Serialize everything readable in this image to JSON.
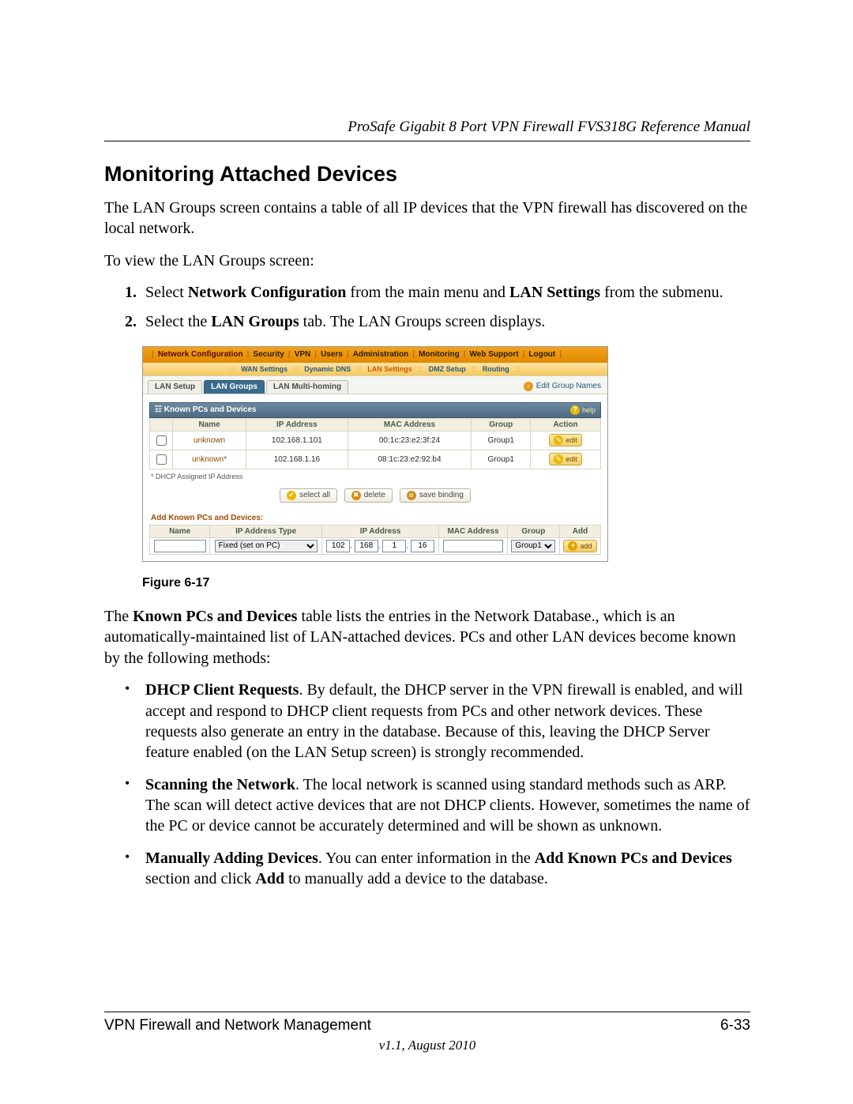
{
  "header": {
    "running_title": "ProSafe Gigabit 8 Port VPN Firewall FVS318G Reference Manual"
  },
  "section_title": "Monitoring Attached Devices",
  "paragraphs": {
    "intro": "The LAN Groups screen contains a table of all IP devices that the VPN firewall has discovered on the local network.",
    "to_view": "To view the LAN Groups screen:",
    "after_figure_pre": "The ",
    "after_figure_bold": "Known PCs and Devices",
    "after_figure_post": " table lists the entries in the Network Database., which is an automatically-maintained list of LAN-attached devices. PCs and other LAN devices become known by the following methods:"
  },
  "steps": {
    "s1_pre": "Select ",
    "s1_b1": "Network Configuration",
    "s1_mid": " from the main menu and ",
    "s1_b2": "LAN Settings",
    "s1_post": " from the submenu.",
    "s2_pre": "Select the ",
    "s2_b1": "LAN Groups",
    "s2_post": " tab. The LAN Groups screen displays."
  },
  "figure": {
    "caption": "Figure 6-17",
    "nav": [
      "Network Configuration",
      "Security",
      "VPN",
      "Users",
      "Administration",
      "Monitoring",
      "Web Support",
      "Logout"
    ],
    "subnav": [
      "WAN Settings",
      "Dynamic DNS",
      "LAN Settings",
      "DMZ Setup",
      "Routing"
    ],
    "subnav_selected_index": 2,
    "tabs": [
      "LAN Setup",
      "LAN Groups",
      "LAN Multi-homing"
    ],
    "tabs_active_index": 1,
    "edit_group_names": "Edit Group Names",
    "panel_title": "Known PCs and Devices",
    "help_label": "help",
    "columns": [
      "Name",
      "IP Address",
      "MAC Address",
      "Group",
      "Action"
    ],
    "rows": [
      {
        "name": "unknown",
        "ip": "102.168.1.101",
        "mac": "00:1c:23:e2:3f:24",
        "group": "Group1",
        "action": "edit"
      },
      {
        "name": "unknown*",
        "ip": "102.168.1.16",
        "mac": "08:1c:23:e2:92:b4",
        "group": "Group1",
        "action": "edit"
      }
    ],
    "footnote": "* DHCP Assigned IP Address",
    "buttons": {
      "select_all": "select all",
      "delete": "delete",
      "save_binding": "save binding"
    },
    "add_section_title": "Add Known PCs and Devices:",
    "add_columns": [
      "Name",
      "IP Address Type",
      "IP Address",
      "MAC Address",
      "Group",
      "Add"
    ],
    "add_row": {
      "name": "",
      "ip_type": "Fixed (set on PC)",
      "ip": [
        "102",
        "168",
        "1",
        "16"
      ],
      "mac": "",
      "group": "Group1",
      "add_label": "add"
    }
  },
  "bullets": {
    "b1_bold": "DHCP Client Requests",
    "b1_text": ". By default, the DHCP server in the VPN firewall is enabled, and will accept and respond to DHCP client requests from PCs and other network devices. These requests also generate an entry in the database. Because of this, leaving the DHCP Server feature enabled (on the LAN Setup screen) is strongly recommended.",
    "b2_bold": "Scanning the Network",
    "b2_text": ". The local network is scanned using standard methods such as ARP. The scan will detect active devices that are not DHCP clients. However, sometimes the name of the PC or device cannot be accurately determined and will be shown as unknown.",
    "b3_bold": "Manually Adding Devices",
    "b3_mid1": ". You can enter information in the ",
    "b3_bold2": "Add Known PCs and Devices",
    "b3_mid2": " section and click ",
    "b3_bold3": "Add",
    "b3_post": " to manually add a device to the database."
  },
  "footer": {
    "left": "VPN Firewall and Network Management",
    "right": "6-33",
    "version": "v1.1, August 2010"
  }
}
